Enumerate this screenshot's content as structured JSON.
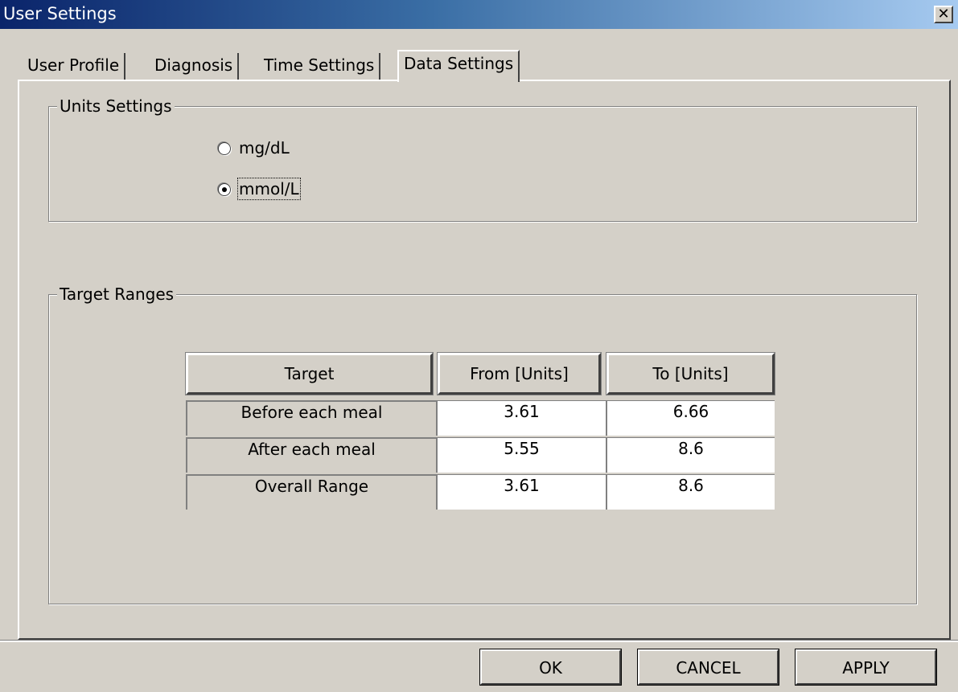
{
  "window": {
    "title": "User Settings",
    "close_glyph": "✕"
  },
  "tabs": [
    {
      "label": "User Profile"
    },
    {
      "label": "Diagnosis"
    },
    {
      "label": "Time Settings"
    },
    {
      "label": "Data Settings",
      "selected": true
    }
  ],
  "units": {
    "group_label": "Units Settings",
    "options": [
      {
        "label": "mg/dL",
        "selected": false
      },
      {
        "label": "mmol/L",
        "selected": true
      }
    ]
  },
  "targets": {
    "group_label": "Target Ranges",
    "columns": [
      "Target",
      "From [Units]",
      "To [Units]"
    ],
    "rows": [
      {
        "target": "Before each meal",
        "from": "3.61",
        "to": "6.66"
      },
      {
        "target": "After each meal",
        "from": "5.55",
        "to": "8.6"
      },
      {
        "target": "Overall Range",
        "from": "3.61",
        "to": "8.6"
      }
    ]
  },
  "buttons": {
    "ok": "OK",
    "cancel": "CANCEL",
    "apply": "APPLY"
  }
}
